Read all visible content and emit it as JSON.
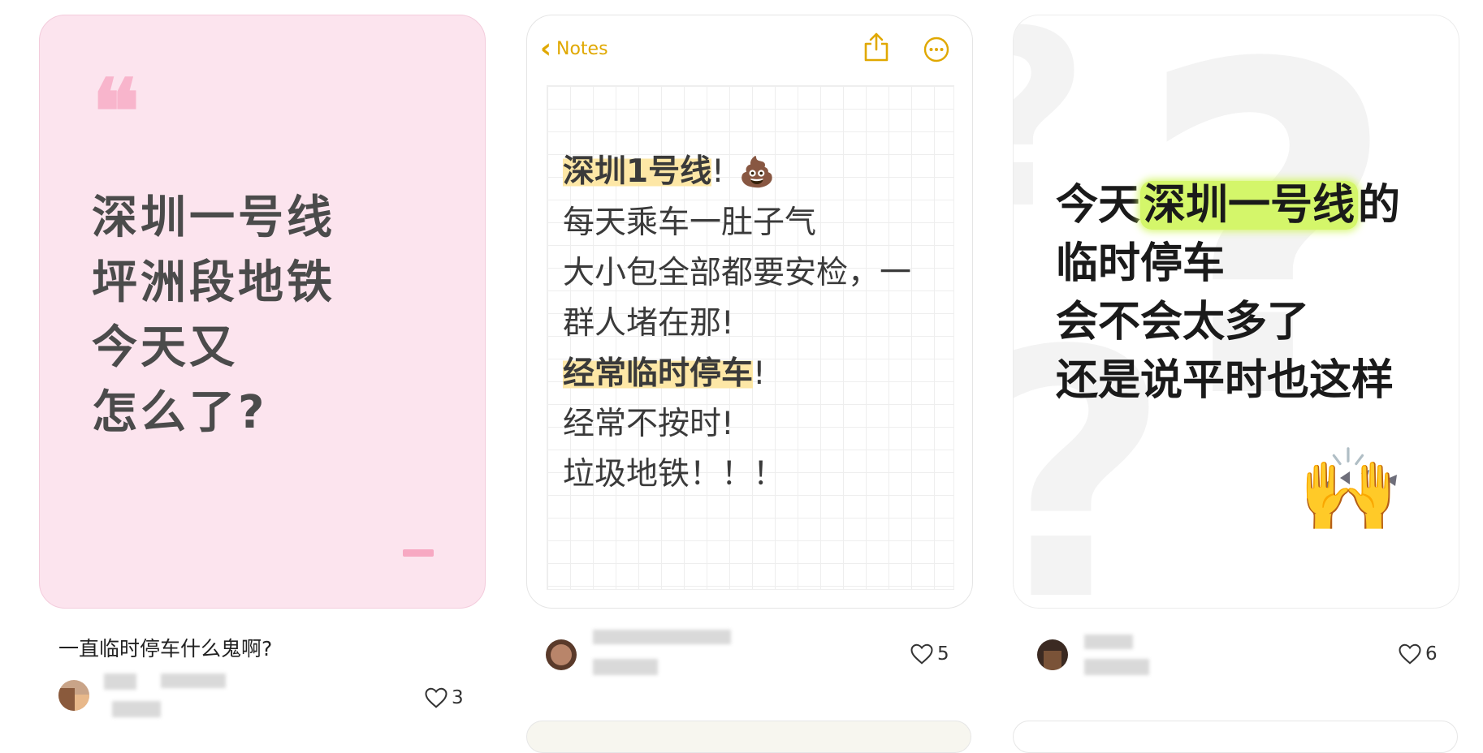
{
  "cards": [
    {
      "quote_glyph": "❝",
      "lines": [
        "深圳一号线",
        "坪洲段地铁",
        "今天又",
        "怎么了?"
      ],
      "caption": "一直临时停车什么鬼啊?",
      "user": {
        "name": "",
        "meta": ""
      },
      "likes": "3"
    },
    {
      "back_label": "Notes",
      "note_title": "深圳1号线",
      "note_title_suffix": "!",
      "note_emoji": "💩",
      "note_lines": [
        "每天乘车一肚子气",
        "大小包全部都要安检，一",
        "群人堵在那!"
      ],
      "note_highlight": "经常临时停车",
      "note_highlight_suffix": "!",
      "note_tail": [
        "经常不按时!",
        "垃圾地铁！！！"
      ],
      "likes": "5"
    },
    {
      "line1_pre": "今天",
      "line1_highlight": "深圳一号线",
      "line1_post": "的",
      "lines": [
        "临时停车",
        "会不会太多了",
        "还是说平时也这样"
      ],
      "emoji": "🙌",
      "likes": "6"
    }
  ],
  "colors": {
    "pink_bg": "#fce4ee",
    "notes_accent": "#e0a800",
    "yellow_highlight": "#fde7a6",
    "green_highlight": "#d4f66a"
  },
  "icons": [
    "chevron-left-icon",
    "share-icon",
    "more-icon",
    "heart-icon"
  ]
}
